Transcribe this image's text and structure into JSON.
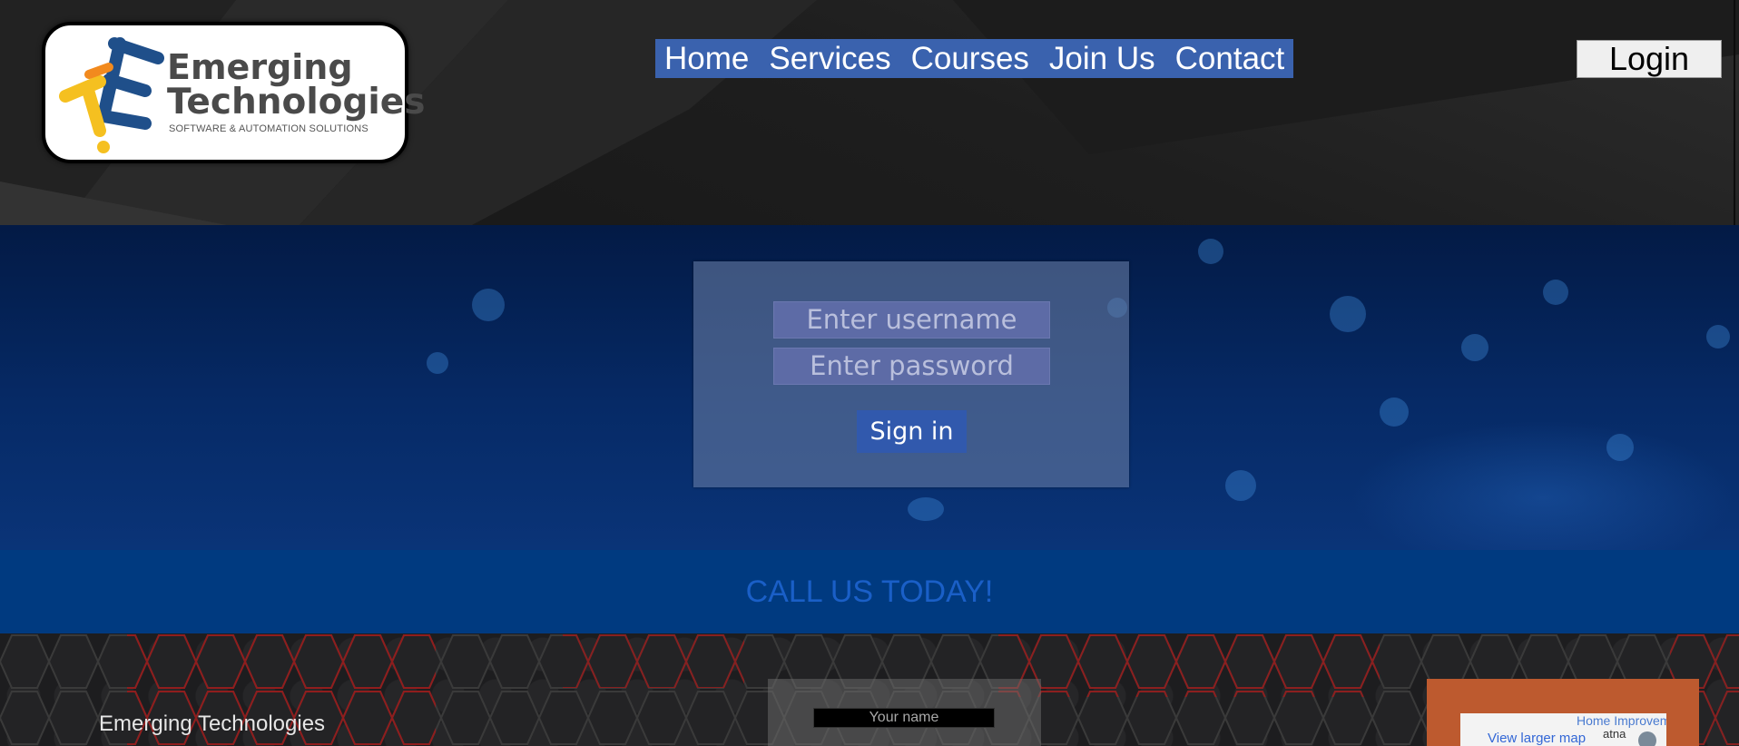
{
  "header": {
    "logo": {
      "line1": "Emerging",
      "line2": "Technologies",
      "tagline": "SOFTWARE & AUTOMATION SOLUTIONS"
    },
    "nav": [
      {
        "label": "Home"
      },
      {
        "label": "Services"
      },
      {
        "label": "Courses"
      },
      {
        "label": "Join Us"
      },
      {
        "label": "Contact"
      }
    ],
    "login_label": "Login"
  },
  "login_form": {
    "username_placeholder": "Enter username",
    "password_placeholder": "Enter password",
    "signin_label": "Sign in"
  },
  "call_band": {
    "text": "CALL US TODAY!"
  },
  "footer": {
    "brand": "Emerging Technologies",
    "contact_form": {
      "name_placeholder": "Your name"
    },
    "map": {
      "view_larger": "View larger map",
      "label_partial": "Home Improvem",
      "street_partial": "atna"
    }
  },
  "colors": {
    "nav_bg": "#3a62ae",
    "call_band_bg": "#003a80",
    "call_text": "#1a5fc7",
    "map_frame": "#bd5a2f",
    "logo_blue": "#1f4f8a",
    "logo_yellow": "#f5c020",
    "logo_orange": "#f28a1e"
  }
}
